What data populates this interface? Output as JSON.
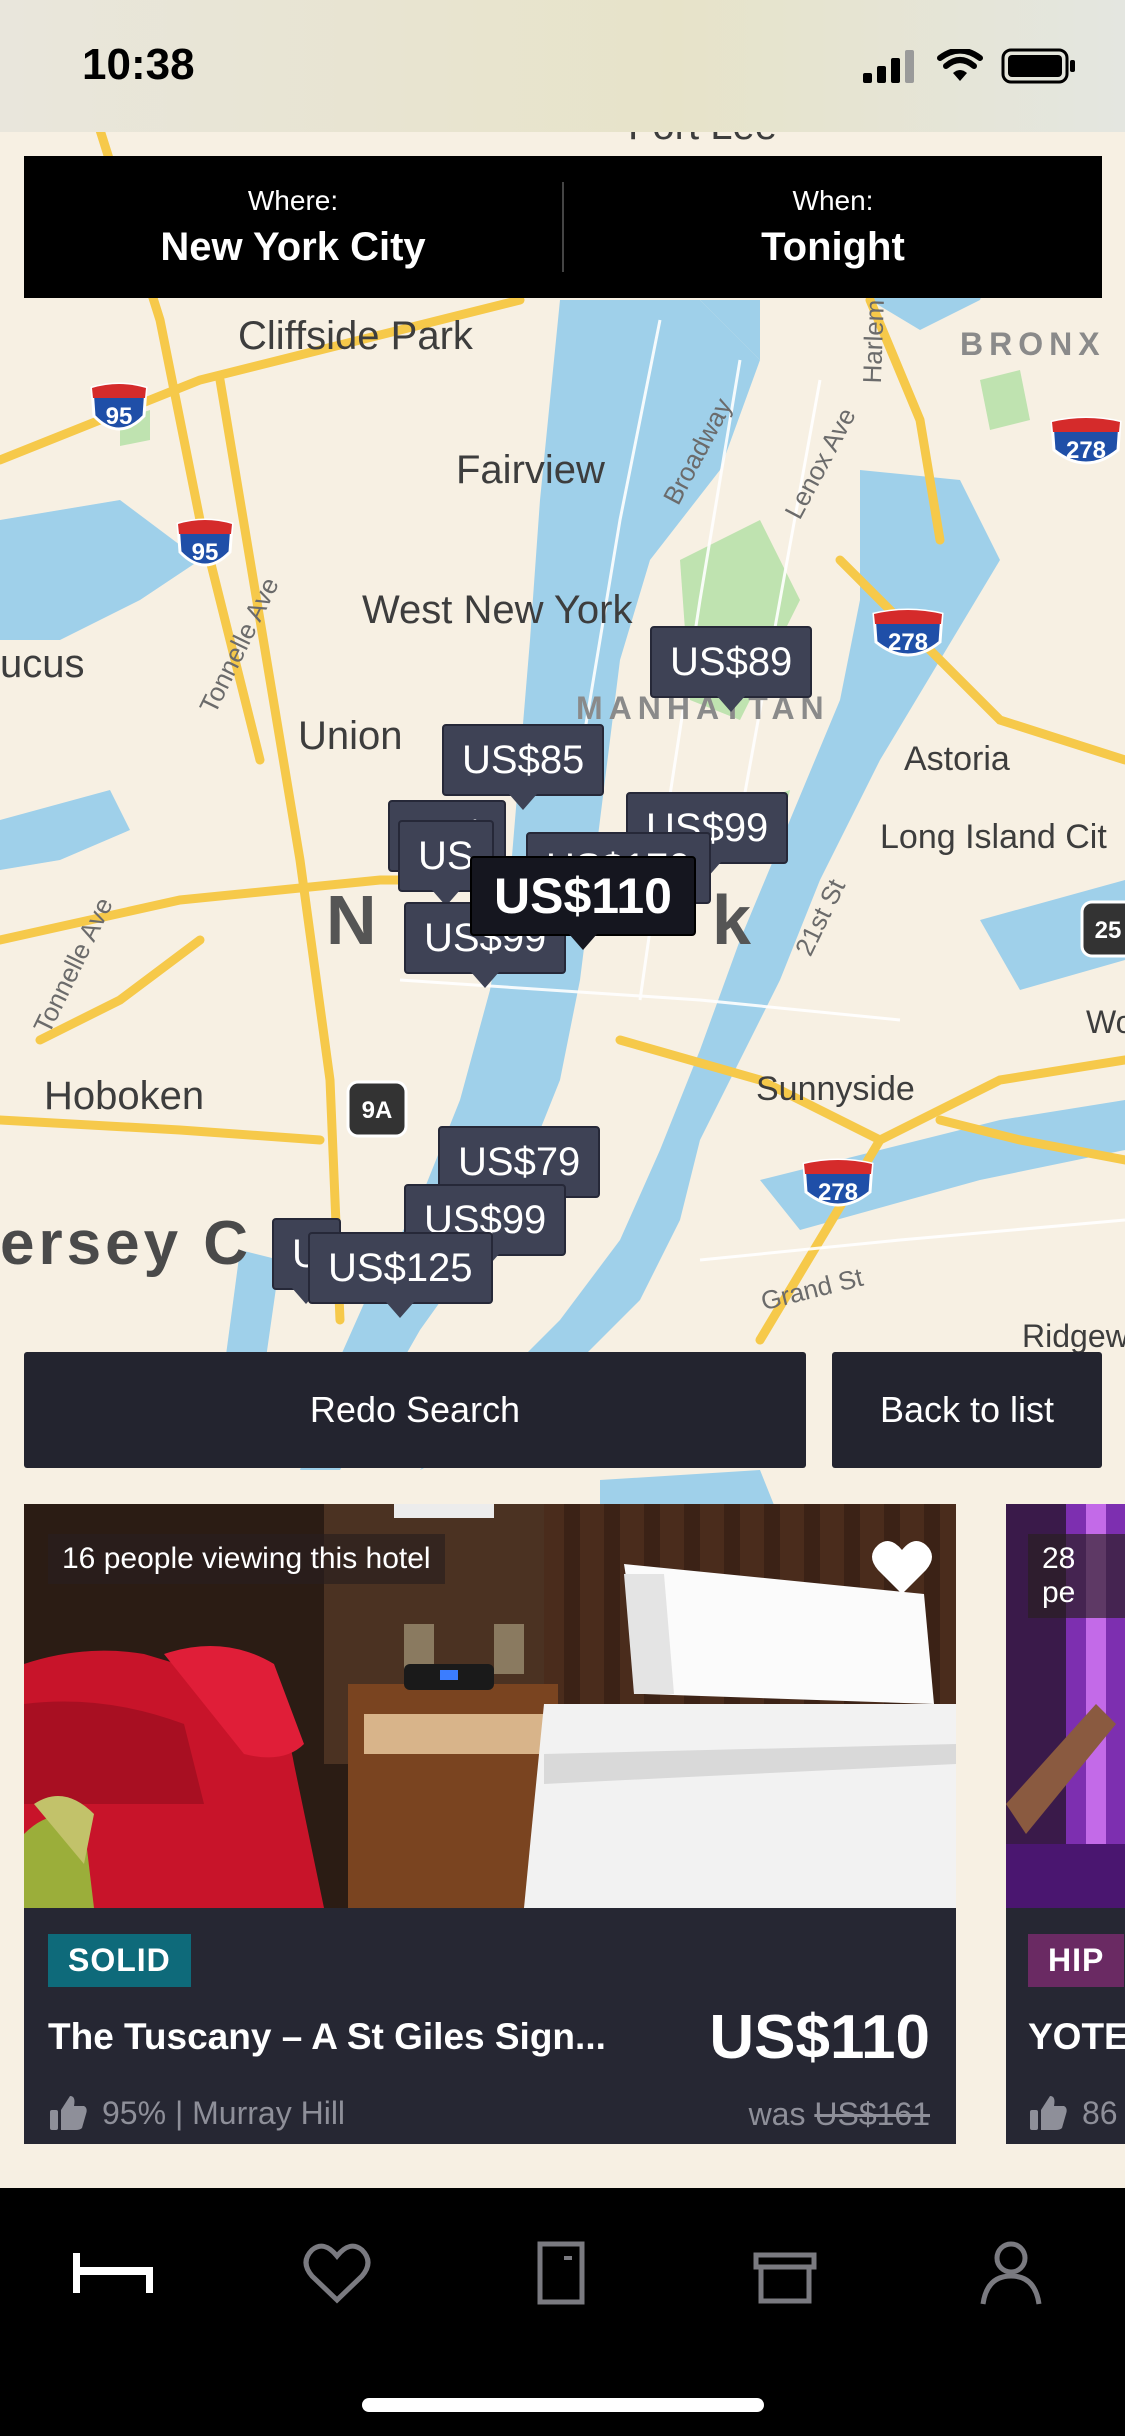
{
  "status_bar": {
    "time": "10:38"
  },
  "search": {
    "where_label": "Where:",
    "where_value": "New York City",
    "when_label": "When:",
    "when_value": "Tonight"
  },
  "map": {
    "places": {
      "cliffside_park": "Cliffside Park",
      "fairview": "Fairview",
      "west_new_york": "West New York",
      "union": "Union",
      "hoboken": "Hoboken",
      "jersey_city": "ersey C",
      "manhattan": "MANHATTAN",
      "bronx": "BRONX",
      "astoria": "Astoria",
      "long_island_city": "Long Island Cit",
      "sunnyside": "Sunnyside",
      "secaucus": "ucus",
      "ridgewood": "Ridgew",
      "fort_lee": "Fort Lee",
      "new_york_partial": "N",
      "new_york_tail": "k"
    },
    "roads": {
      "broadway": "Broadway",
      "lenox": "Lenox Ave",
      "harlem": "Harlem",
      "tonnelle1": "Tonnelle Ave",
      "tonnelle2": "Tonnelle Ave",
      "st21": "21st St",
      "grand": "Grand St",
      "wo": "Wo"
    },
    "shields": {
      "i95_a": "95",
      "i95_b": "95",
      "i278_a": "278",
      "i278_b": "278",
      "i278_c": "278",
      "r9a": "9A",
      "r25": "25"
    },
    "price_pins": [
      "US$89",
      "US$85",
      "US$99",
      "US$",
      "US",
      "US$170",
      "US$110",
      "US$99",
      "US$79",
      "US$99",
      "U",
      "US$125"
    ]
  },
  "buttons": {
    "redo_search": "Redo Search",
    "back_to_list": "Back to list"
  },
  "hotels": [
    {
      "viewers": "16 people viewing this hotel",
      "tag": "SOLID",
      "tag_color": "#0e6a7a",
      "name": "The Tuscany – A St Giles Sign...",
      "price": "US$110",
      "rating": "95% | Murray Hill",
      "was_label": "was",
      "was_price": "US$161"
    },
    {
      "viewers": "28 pe",
      "tag": "HIP",
      "tag_color": "#6a2a63",
      "name": "YOTE",
      "rating": "86"
    }
  ],
  "tabs": [
    "hotel-tonight",
    "favorites",
    "bookings",
    "rewards",
    "profile"
  ]
}
